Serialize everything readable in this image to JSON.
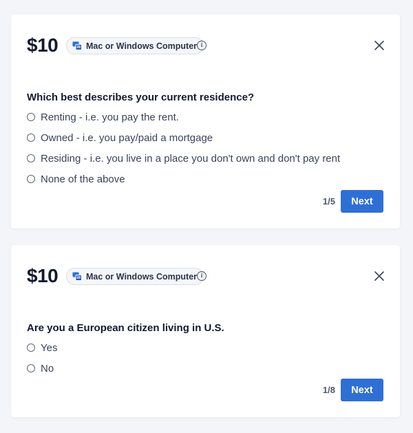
{
  "colors": {
    "page_background": "#f4f5f8",
    "card_background": "#ffffff",
    "accent": "#2f6fd5",
    "heading_text": "#111a2e",
    "body_text": "#3a4358"
  },
  "surveys": [
    {
      "price": "$10",
      "device": {
        "icon": "devices-icon",
        "label": "Mac or Windows Computer"
      },
      "info_icon": "info-icon",
      "close_icon": "close-icon",
      "question": "Which best describes your current residence?",
      "options": [
        "Renting - i.e. you pay the rent.",
        "Owned - i.e. you pay/paid a mortgage",
        "Residing - i.e. you live in a place you don't own and don't pay rent",
        "None of the above"
      ],
      "step": "1/5",
      "next_label": "Next"
    },
    {
      "price": "$10",
      "device": {
        "icon": "devices-icon",
        "label": "Mac or Windows Computer"
      },
      "info_icon": "info-icon",
      "close_icon": "close-icon",
      "question": "Are you a European citizen living in U.S.",
      "options": [
        "Yes",
        "No"
      ],
      "step": "1/8",
      "next_label": "Next"
    }
  ]
}
